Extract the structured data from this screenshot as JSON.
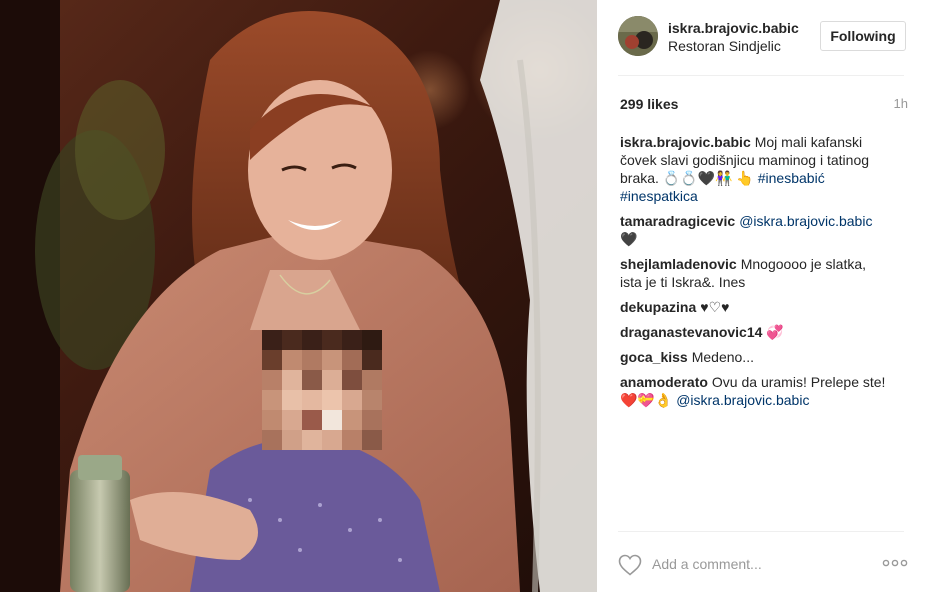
{
  "post": {
    "username": "iskra.brajovic.babic",
    "location": "Restoran Sindjelic",
    "follow_label": "Following",
    "likes": "299 likes",
    "time": "1h"
  },
  "caption": {
    "user": "iskra.brajovic.babic",
    "text": "Moj mali kafanski čovek slavi godišnjicu maminog i tatinog braka. 💍💍🖤👫 👆",
    "hashtags": [
      "#inesbabić",
      "#inespatkica"
    ]
  },
  "comments": [
    {
      "user": "tamaradragicevic",
      "mention": "@iskra.brajovic.babic",
      "text": "🖤"
    },
    {
      "user": "shejlamladenovic",
      "text": "Mnogoooo je slatka, ista je ti Iskra&. Ines"
    },
    {
      "user": "dekupazina",
      "text": "♥♡♥"
    },
    {
      "user": "draganastevanovic14",
      "text": "💞"
    },
    {
      "user": "goca_kiss",
      "text": "Medeno..."
    },
    {
      "user": "anamoderato",
      "text": "Ovu da uramis! Prelepe ste!",
      "emoji": "❤️💝👌",
      "mention": "@iskra.brajovic.babic"
    }
  ],
  "add_comment": {
    "placeholder": "Add a comment..."
  },
  "icons": {
    "like": "heart-outline-icon",
    "more": "more-options-icon"
  },
  "colors": {
    "link": "#003569",
    "text": "#262626",
    "muted": "#999999",
    "border": "#dbdbdb"
  }
}
